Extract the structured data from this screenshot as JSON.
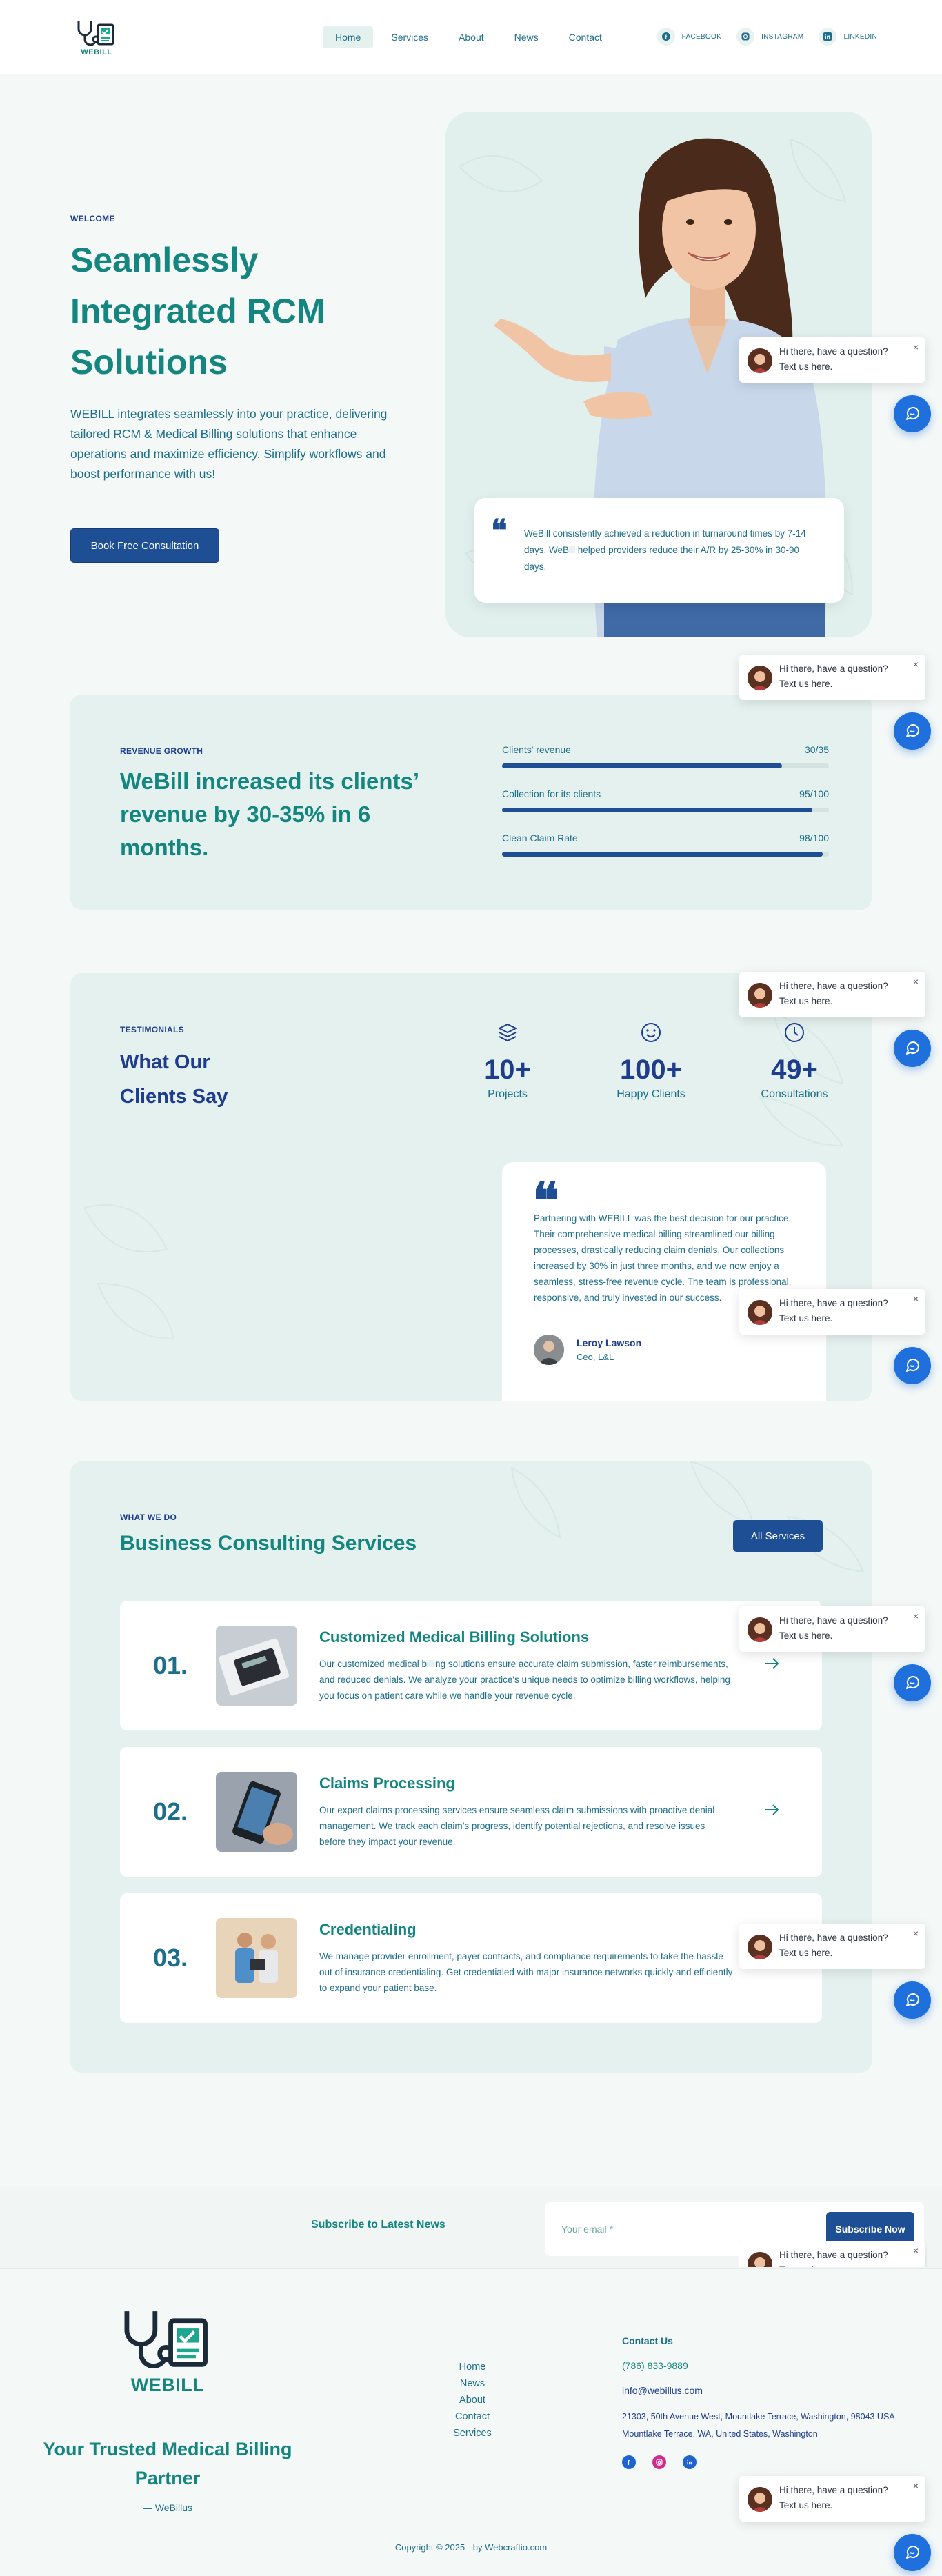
{
  "header": {
    "logo_text": "WEBILL",
    "nav": [
      {
        "label": "Home",
        "active": true
      },
      {
        "label": "Services",
        "active": false
      },
      {
        "label": "About",
        "active": false
      },
      {
        "label": "News",
        "active": false
      },
      {
        "label": "Contact",
        "active": false
      }
    ],
    "social": [
      {
        "label": "FACEBOOK",
        "icon": "facebook-icon"
      },
      {
        "label": "INSTAGRAM",
        "icon": "instagram-icon"
      },
      {
        "label": "LINKEDIN",
        "icon": "linkedin-icon"
      }
    ]
  },
  "hero": {
    "eyebrow": "WELCOME",
    "title": "Seamlessly Integrated RCM Solutions",
    "body": "WEBILL integrates seamlessly into your practice, delivering tailored RCM & Medical Billing solutions that enhance operations and maximize efficiency. Simplify workflows and boost performance with us!",
    "cta": "Book Free Consultation",
    "quote": "WeBill consistently achieved a reduction in turnaround times by 7-14 days. WeBill helped providers reduce their A/R by 25-30% in 30-90 days."
  },
  "revenue": {
    "eyebrow": "REVENUE GROWTH",
    "title": "WeBill increased its clients’ revenue by 30-35% in 6 months.",
    "bars": [
      {
        "label": "Clients' revenue",
        "value_text": "30/35",
        "fraction": 0.857
      },
      {
        "label": "Collection for its clients",
        "value_text": "95/100",
        "fraction": 0.95
      },
      {
        "label": "Clean Claim Rate",
        "value_text": "98/100",
        "fraction": 0.98
      }
    ]
  },
  "testimonials": {
    "eyebrow": "TESTIMONIALS",
    "title": "What Our Clients Say",
    "stats": [
      {
        "number": "10+",
        "label": "Projects",
        "icon": "layers-icon"
      },
      {
        "number": "100+",
        "label": "Happy Clients",
        "icon": "smiley-icon"
      },
      {
        "number": "49+",
        "label": "Consultations",
        "icon": "clock-icon"
      }
    ],
    "quote": "Partnering with WEBILL was the best decision for our practice. Their comprehensive medical billing streamlined our billing processes, drastically reducing claim denials. Our collections increased by 30% in just three months, and we now enjoy a seamless, stress-free revenue cycle. The team is professional, responsive, and truly invested in our success.",
    "author_name": "Leroy Lawson",
    "author_role": "Ceo, L&L"
  },
  "services": {
    "eyebrow": "WHAT WE DO",
    "title": "Business Consulting Services",
    "all_button": "All Services",
    "items": [
      {
        "number": "01.",
        "title": "Customized Medical Billing Solutions",
        "desc": "Our customized medical billing solutions ensure accurate claim submission, faster reimbursements, and reduced denials. We analyze your practice's unique needs to optimize billing workflows, helping you focus on patient care while we handle your revenue cycle."
      },
      {
        "number": "02.",
        "title": "Claims Processing",
        "desc": "Our expert claims processing services ensure seamless claim submissions with proactive denial management. We track each claim’s progress, identify potential rejections, and resolve issues before they impact your revenue."
      },
      {
        "number": "03.",
        "title": "Credentialing",
        "desc": "We manage provider enrollment, payer contracts, and compliance requirements to take the hassle out of insurance credentialing. Get credentialed with major insurance networks quickly and efficiently to expand your patient base."
      }
    ]
  },
  "subscribe": {
    "label": "Subscribe to Latest News",
    "placeholder": "Your email *",
    "button": "Subscribe Now"
  },
  "footer": {
    "logo_text": "WEBILL",
    "tagline": "Your Trusted Medical Billing Partner",
    "signature": "— WeBillus",
    "links": [
      "Home",
      "News",
      "About",
      "Contact",
      "Services"
    ],
    "contact_heading": "Contact Us",
    "phone": "(786) 833-9889",
    "email": "info@webillus.com",
    "address": "21303, 50th Avenue West, Mountlake Terrace, Washington, 98043 USA, Mountlake Terrace, WA, United States, Washington",
    "copyright": "Copyright © 2025 - by Webcraftio.com"
  },
  "chat": {
    "message": "Hi there, have a question? Text us here.",
    "close": "×"
  },
  "colors": {
    "teal": "#14867f",
    "navy": "#1e4f95",
    "panel": "#e4f1ee",
    "chat_blue": "#1f6fdc"
  }
}
